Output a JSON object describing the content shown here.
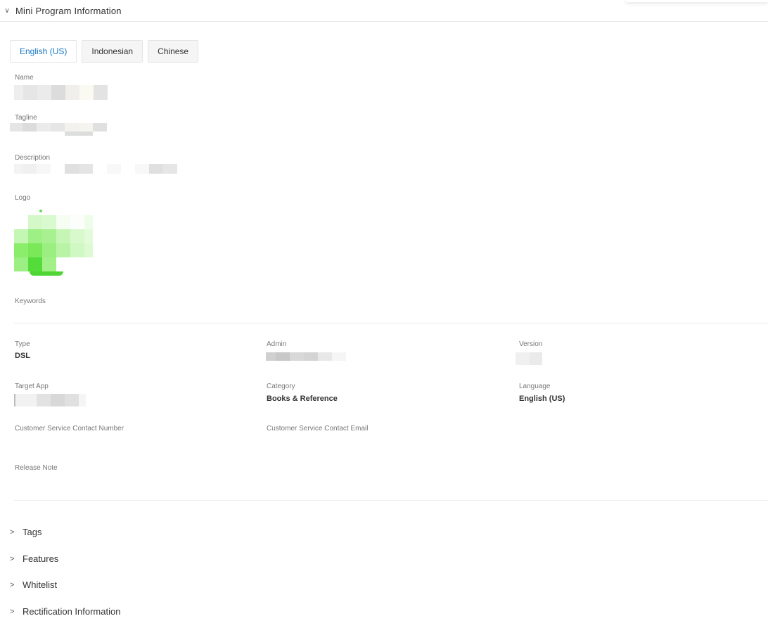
{
  "section": {
    "title": "Mini Program Information",
    "chevron_icon": "chevron-down-icon"
  },
  "language_tabs": [
    {
      "label": "English (US)",
      "active": true
    },
    {
      "label": "Indonesian",
      "active": false
    },
    {
      "label": "Chinese",
      "active": false
    }
  ],
  "fields": {
    "name_label": "Name",
    "tagline_label": "Tagline",
    "description_label": "Description",
    "logo_label": "Logo",
    "keywords_label": "Keywords"
  },
  "details": {
    "type_label": "Type",
    "type_value": "DSL",
    "admin_label": "Admin",
    "version_label": "Version",
    "target_app_label": "Target App",
    "category_label": "Category",
    "category_value": "Books & Reference",
    "language_label": "Language",
    "language_value": "English (US)",
    "cs_phone_label": "Customer Service Contact Number",
    "cs_email_label": "Customer Service Contact Email",
    "release_note_label": "Release Note"
  },
  "collapsed_sections": [
    {
      "label": "Tags",
      "icon": "chevron-right-icon"
    },
    {
      "label": "Features",
      "icon": "chevron-right-icon"
    },
    {
      "label": "Whitelist",
      "icon": "chevron-right-icon"
    },
    {
      "label": "Rectification Information",
      "icon": "chevron-right-icon"
    }
  ],
  "colors": {
    "accent": "#1677c4",
    "logo_green": "#4cd137"
  }
}
